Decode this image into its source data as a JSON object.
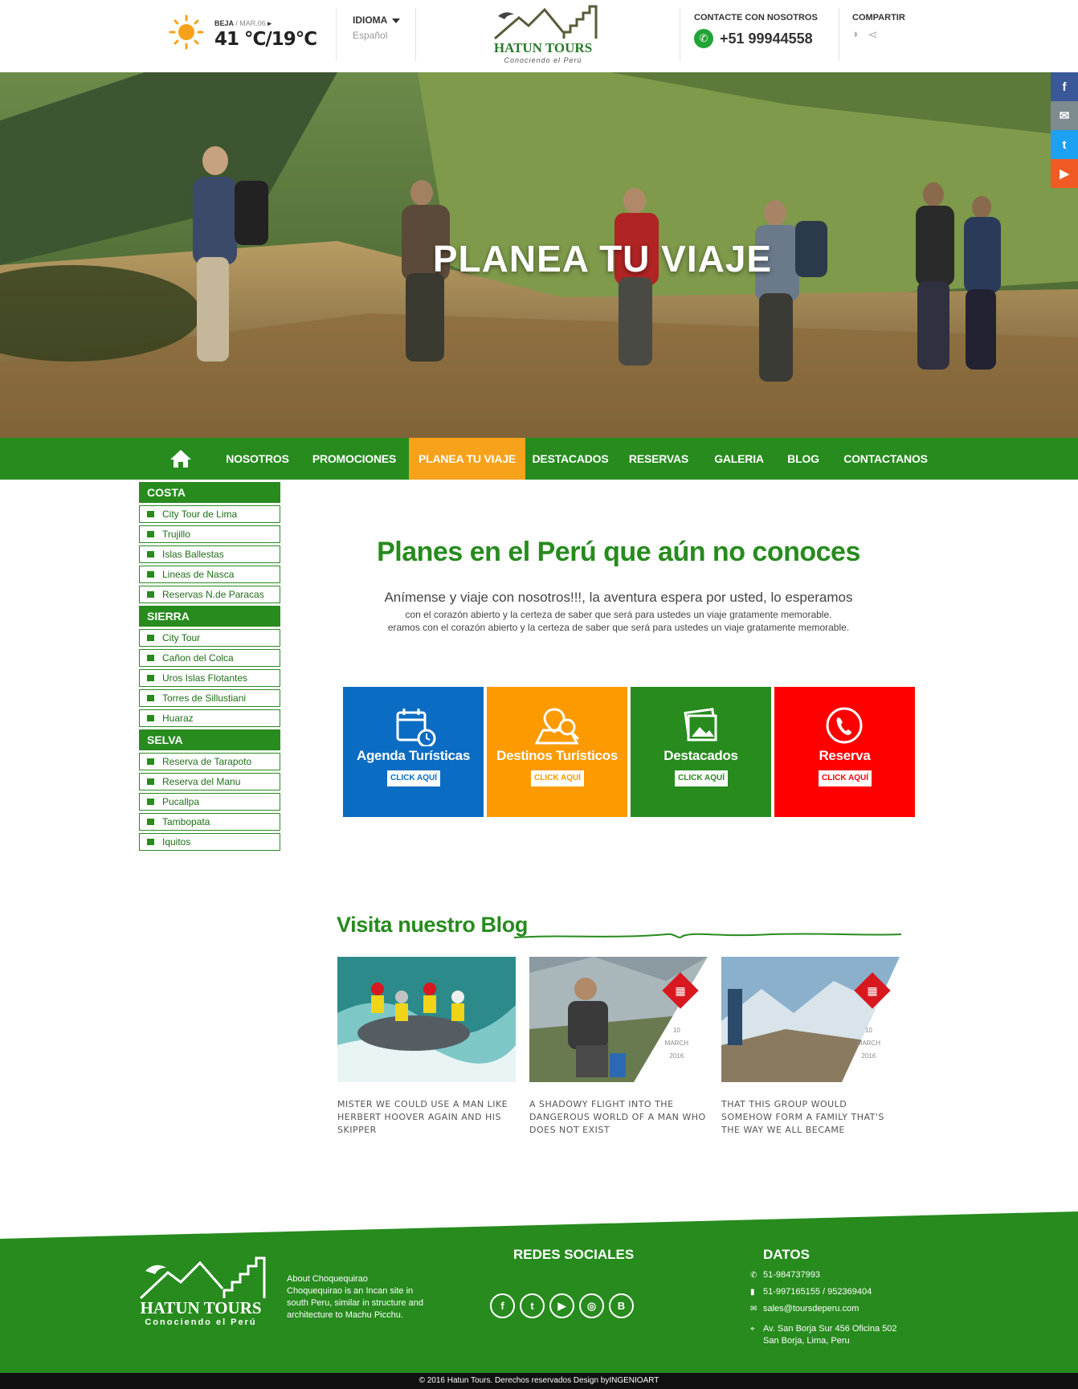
{
  "header": {
    "weather": {
      "location": "BEJA",
      "date": "/ MAR.06",
      "temperature": "41 °C/19°C"
    },
    "language": {
      "label": "IDIOMA",
      "value": "Español"
    },
    "logo": {
      "name": "HATUN TOURS",
      "tagline": "Conociendo el Perú"
    },
    "contact": {
      "label": "CONTACTE CON NOSOTROS",
      "phone": "+51 99944558"
    },
    "share": {
      "label": "COMPARTIR"
    }
  },
  "hero": {
    "title": "PLANEA TU VIAJE"
  },
  "side_social": [
    {
      "icon": "facebook-icon",
      "glyph": "f",
      "color": "#3b5998"
    },
    {
      "icon": "mail-icon",
      "glyph": "✉",
      "color": "#7d8a8e"
    },
    {
      "icon": "twitter-icon",
      "glyph": "t",
      "color": "#1da1f2"
    },
    {
      "icon": "youtube-icon",
      "glyph": "▶",
      "color": "#f15a24"
    }
  ],
  "nav": {
    "items": [
      "NOSOTROS",
      "PROMOCIONES",
      "PLANEA TU VIAJE",
      "DESTACADOS",
      "RESERVAS",
      "GALERIA",
      "BLOG",
      "CONTACTANOS"
    ],
    "active": "PLANEA TU VIAJE"
  },
  "sidebar": {
    "costa": {
      "title": "COSTA",
      "items": [
        "City Tour de Lima",
        "Trujillo",
        "Islas Ballestas",
        "Lineas de Nasca",
        "Reservas N.de Paracas"
      ]
    },
    "sierra": {
      "title": "SIERRA",
      "items": [
        "City Tour",
        "Cañon del Colca",
        "Uros Islas Flotantes",
        "Torres de Sillustiani",
        "Huaraz"
      ]
    },
    "selva": {
      "title": "SELVA",
      "items": [
        "Reserva de Tarapoto",
        "Reserva del Manu",
        "Pucallpa",
        "Tambopata",
        "Iquitos"
      ]
    }
  },
  "intro": {
    "title": "Planes en el Perú que aún no conoces",
    "lead": "Anímense y viaje con nosotros!!!, la aventura espera por usted, lo esperamos",
    "line1": "con el corazón abierto y la certeza de saber que será para ustedes un viaje gratamente memorable.",
    "line2": "eramos con el corazón abierto y la certeza de saber que será para ustedes un viaje gratamente memorable."
  },
  "tiles": [
    {
      "title": "Agenda Turísticas",
      "button": "CLICK AQUÍ",
      "color": "#0a6cc2"
    },
    {
      "title": "Destinos Turísticos",
      "button": "CLICK AQUÍ",
      "color": "#fd9a00"
    },
    {
      "title": "Destacados",
      "button": "CLICK AQUÍ",
      "color": "#278b1e"
    },
    {
      "title": "Reserva",
      "button": "CLICK AQUÍ",
      "color": "#fe0000"
    }
  ],
  "blog": {
    "title": "Visita nuestro Blog",
    "posts": [
      {
        "caption": "MISTER WE COULD USE A MAN LIKE HERBERT HOOVER AGAIN AND HIS SKIPPER"
      },
      {
        "caption": "A SHADOWY FLIGHT INTO THE DANGEROUS WORLD OF A MAN WHO DOES NOT EXIST",
        "day": "10",
        "month": "MARCH",
        "year": "2016"
      },
      {
        "caption": "THAT THIS GROUP WOULD SOMEHOW FORM A FAMILY THAT'S THE WAY WE ALL BECAME",
        "day": "10",
        "month": "MARCH",
        "year": "2016"
      }
    ]
  },
  "footer": {
    "logo_name": "HATUN TOURS",
    "logo_tagline": "Conociendo el Perú",
    "about_title": "About Choquequirao",
    "about_text": "Choquequirao is an Incan site in south Peru, similar in structure and architecture to Machu Picchu.",
    "social_title": "REDES SOCIALES",
    "social": [
      {
        "icon": "facebook-icon",
        "glyph": "f"
      },
      {
        "icon": "twitter-icon",
        "glyph": "t"
      },
      {
        "icon": "youtube-icon",
        "glyph": "▶"
      },
      {
        "icon": "instagram-icon",
        "glyph": "◎"
      },
      {
        "icon": "blogger-icon",
        "glyph": "B"
      }
    ],
    "datos_title": "DATOS",
    "phone1": "51-984737993",
    "phone2": "51-997165155 / 952369404",
    "email": "sales@toursdeperu.com",
    "address1": "Av. San Borja Sur 456 Oficina 502",
    "address2": "San Borja, Lima, Peru",
    "copyright": "© 2016  Hatun Tours. Derechos reservados Design byINGENIOART"
  }
}
